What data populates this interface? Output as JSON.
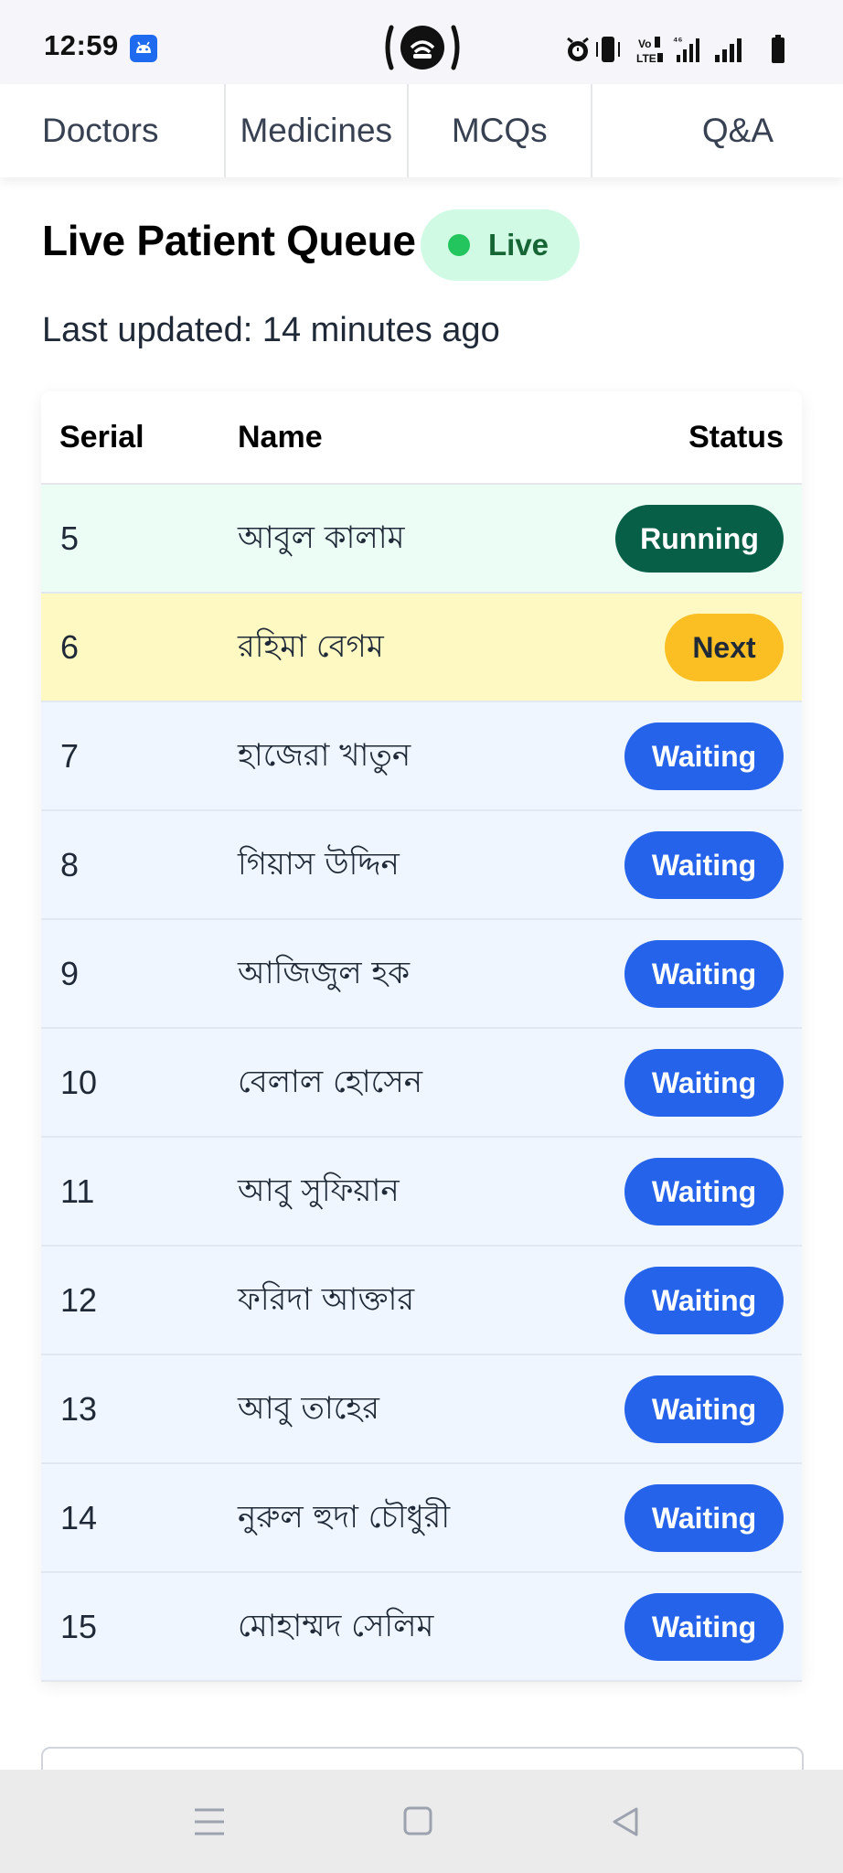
{
  "status_bar": {
    "time": "12:59",
    "colors": {
      "background": "#f5f5fa",
      "app_icon": "#1e6bf0"
    }
  },
  "tabs": [
    {
      "label": "Doctors"
    },
    {
      "label": "Medicines"
    },
    {
      "label": "MCQs"
    },
    {
      "label": "Q&A"
    }
  ],
  "header": {
    "title": "Live Patient Queue",
    "live_label": "Live",
    "last_updated": "Last updated: 14 minutes ago"
  },
  "table": {
    "columns": {
      "serial": "Serial",
      "name": "Name",
      "status": "Status"
    },
    "rows": [
      {
        "serial": "5",
        "name": "আবুল কালাম",
        "status": "Running"
      },
      {
        "serial": "6",
        "name": "রহিমা বেগম",
        "status": "Next"
      },
      {
        "serial": "7",
        "name": "হাজেরা খাতুন",
        "status": "Waiting"
      },
      {
        "serial": "8",
        "name": "গিয়াস উদ্দিন",
        "status": "Waiting"
      },
      {
        "serial": "9",
        "name": "আজিজুল হক",
        "status": "Waiting"
      },
      {
        "serial": "10",
        "name": "বেলাল হোসেন",
        "status": "Waiting"
      },
      {
        "serial": "11",
        "name": "আবু সুফিয়ান",
        "status": "Waiting"
      },
      {
        "serial": "12",
        "name": "ফরিদা আক্তার",
        "status": "Waiting"
      },
      {
        "serial": "13",
        "name": "আবু তাহের",
        "status": "Waiting"
      },
      {
        "serial": "14",
        "name": "নুরুল হুদা চৌধুরী",
        "status": "Waiting"
      },
      {
        "serial": "15",
        "name": "মোহাম্মদ সেলিম",
        "status": "Waiting"
      }
    ]
  },
  "status_styles": {
    "Running": {
      "row_bg": "#ecfdf5",
      "pill_bg": "#065f46",
      "pill_fg": "#ffffff"
    },
    "Next": {
      "row_bg": "#fef9c3",
      "pill_bg": "#fbbf24",
      "pill_fg": "#1f2937"
    },
    "Waiting": {
      "row_bg": "#eff6ff",
      "pill_bg": "#2563eb",
      "pill_fg": "#ffffff"
    }
  },
  "nav_bar": {
    "icons": [
      "menu-icon",
      "home-square-icon",
      "back-triangle-icon"
    ],
    "background": "#ebebeb"
  }
}
